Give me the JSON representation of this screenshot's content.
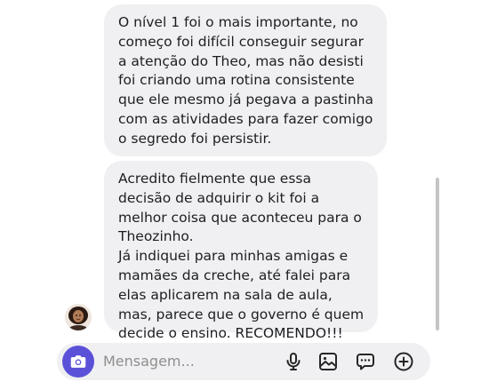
{
  "messages": [
    {
      "id": "msg1",
      "text": "O nível 1 foi o mais importante, no começo foi difícil conseguir segurar a atenção do Theo, mas não desisti foi criando uma rotina consistente que ele mesmo já pegava a pastinha com as atividades para fazer comigo o segredo foi persistir."
    },
    {
      "id": "msg2",
      "text": "Acredito fielmente que essa decisão de adquirir o kit foi a melhor coisa que aconteceu para o Theozinho.\nJá indiquei para minhas amigas e mamães da creche, até falei para elas aplicarem na sala de aula, mas, parece que o governo é quem decide o ensino. RECOMENDO!!!"
    }
  ],
  "composer": {
    "placeholder": "Mensagem...",
    "icons": [
      "camera-icon",
      "microphone-icon",
      "image-icon",
      "sticker-icon",
      "add-icon"
    ]
  },
  "colors": {
    "bubble": "#f0f0f2",
    "accent": "#5b51d8",
    "text": "#1c1e21",
    "placeholder": "#8e8e8e"
  }
}
